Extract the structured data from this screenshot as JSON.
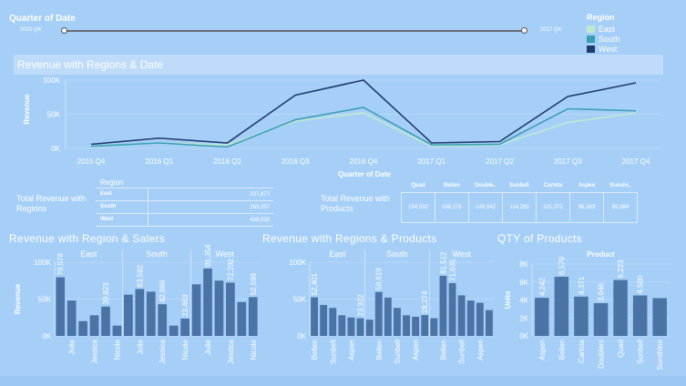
{
  "filter": {
    "title": "Quarter of Date",
    "start": "2015 Q4",
    "end": "2017 Q4"
  },
  "legend": {
    "title": "Region",
    "items": [
      {
        "label": "East",
        "color": "#bfe8d0"
      },
      {
        "label": "South",
        "color": "#3a9fb5"
      },
      {
        "label": "West",
        "color": "#1f3b6e"
      }
    ]
  },
  "line_section": {
    "title": "Revenue with Regions & Date"
  },
  "tables": {
    "regions": {
      "title": "Total Revenue with Regions",
      "header": "Region",
      "rows": [
        {
          "label": "East",
          "value": "237,877"
        },
        {
          "label": "South",
          "value": "263,257"
        },
        {
          "label": "West",
          "value": "408,038"
        }
      ]
    },
    "products": {
      "title": "Total Revenue with Products",
      "headers": [
        "Quad",
        "Bellen",
        "Double..",
        "Sunbell",
        "Carlota",
        "Aspen",
        "Sunshi.."
      ],
      "values": [
        "194,032",
        "168,175",
        "149,042",
        "114,283",
        "101,272",
        "96,383",
        "85,984"
      ]
    }
  },
  "bottom_titles": {
    "salers": "Revenue with Region & Salers",
    "products": "Revenue with Regions & Products",
    "qty": "QTY  of Products"
  },
  "chart_data": [
    {
      "type": "line",
      "title": "Revenue with Regions & Date",
      "xlabel": "Quarter of Date",
      "ylabel": "Revenue",
      "categories": [
        "2015 Q4",
        "2016 Q1",
        "2016 Q2",
        "2016 Q3",
        "2016 Q4",
        "2017 Q1",
        "2017 Q2",
        "2017 Q3",
        "2017 Q4"
      ],
      "ylim": [
        0,
        100000
      ],
      "yticks": [
        "0K",
        "50K",
        "100K"
      ],
      "series": [
        {
          "name": "East",
          "color": "#bfe8d0",
          "values": [
            2000,
            8000,
            5000,
            40000,
            52000,
            3000,
            5000,
            38000,
            52000
          ]
        },
        {
          "name": "South",
          "color": "#3a9fb5",
          "values": [
            3000,
            8000,
            2000,
            42000,
            60000,
            5000,
            6000,
            58000,
            55000
          ]
        },
        {
          "name": "West",
          "color": "#1f3b6e",
          "values": [
            6000,
            15000,
            8000,
            78000,
            100000,
            8000,
            10000,
            76000,
            96000
          ]
        }
      ]
    },
    {
      "type": "bar",
      "title": "Revenue with Region & Salers",
      "ylabel": "Revenue",
      "ylim": [
        0,
        100000
      ],
      "yticks": [
        "0K",
        "50K",
        "100K"
      ],
      "groups": [
        "East",
        "South",
        "West"
      ],
      "categories": [
        "",
        "Julie",
        "",
        "Jessica",
        "",
        "Nicole",
        "",
        "Julie",
        "",
        "Jessica",
        "",
        "Nicole",
        "",
        "Julie",
        "",
        "Jessica",
        "",
        "Nicole"
      ],
      "group_of": [
        0,
        0,
        0,
        0,
        0,
        0,
        1,
        1,
        1,
        1,
        1,
        1,
        2,
        2,
        2,
        2,
        2,
        2
      ],
      "values": [
        79578,
        48000,
        20000,
        28000,
        39823,
        14000,
        56000,
        63592,
        60000,
        42986,
        14000,
        23463,
        70000,
        91354,
        75000,
        72292,
        46000,
        52599
      ],
      "labels": [
        "79,578",
        "",
        "",
        "",
        "39,823",
        "",
        "",
        "63,592",
        "",
        "42,986",
        "",
        "23,463",
        "",
        "91,354",
        "",
        "72,292",
        "",
        "52,599"
      ]
    },
    {
      "type": "bar",
      "title": "Revenue with Regions & Products",
      "ylim": [
        0,
        100000
      ],
      "yticks": [
        "0K",
        "50K",
        "100K"
      ],
      "groups": [
        "East",
        "South",
        "West"
      ],
      "categories": [
        "Bellen",
        "",
        "Sunbell",
        "",
        "Aspen",
        "",
        "",
        "Bellen",
        "",
        "Sunbell",
        "",
        "Aspen",
        "",
        "",
        "Bellen",
        "",
        "Sunbell",
        "",
        "Aspen",
        ""
      ],
      "group_of": [
        0,
        0,
        0,
        0,
        0,
        0,
        1,
        1,
        1,
        1,
        1,
        1,
        1,
        2,
        2,
        2,
        2,
        2,
        2,
        2
      ],
      "values": [
        52401,
        42000,
        38000,
        28000,
        25000,
        23922,
        22000,
        59619,
        52000,
        38000,
        28000,
        26000,
        28274,
        24000,
        81512,
        71635,
        55000,
        48000,
        45000,
        35000
      ],
      "labels": [
        "52,401",
        "",
        "",
        "",
        "",
        "23,922",
        "",
        "59,619",
        "",
        "",
        "",
        "",
        "28,274",
        "",
        "81,512",
        "71,635",
        "",
        "",
        "",
        ""
      ]
    },
    {
      "type": "bar",
      "title": "QTY  of Products",
      "xlabel": "Product",
      "ylabel": "Units",
      "ylim": [
        0,
        8000
      ],
      "yticks": [
        "0K",
        "2K",
        "4K",
        "6K",
        "8K"
      ],
      "categories": [
        "Aspen",
        "Bellen",
        "Carlota",
        "Doublers",
        "Quad",
        "Sunbell",
        "Sunshine"
      ],
      "values": [
        4242,
        6579,
        4371,
        3646,
        6223,
        4500,
        4200
      ],
      "labels": [
        "4,242",
        "6,579",
        "4,371",
        "3,646",
        "6,223",
        "4,500",
        ""
      ]
    }
  ]
}
